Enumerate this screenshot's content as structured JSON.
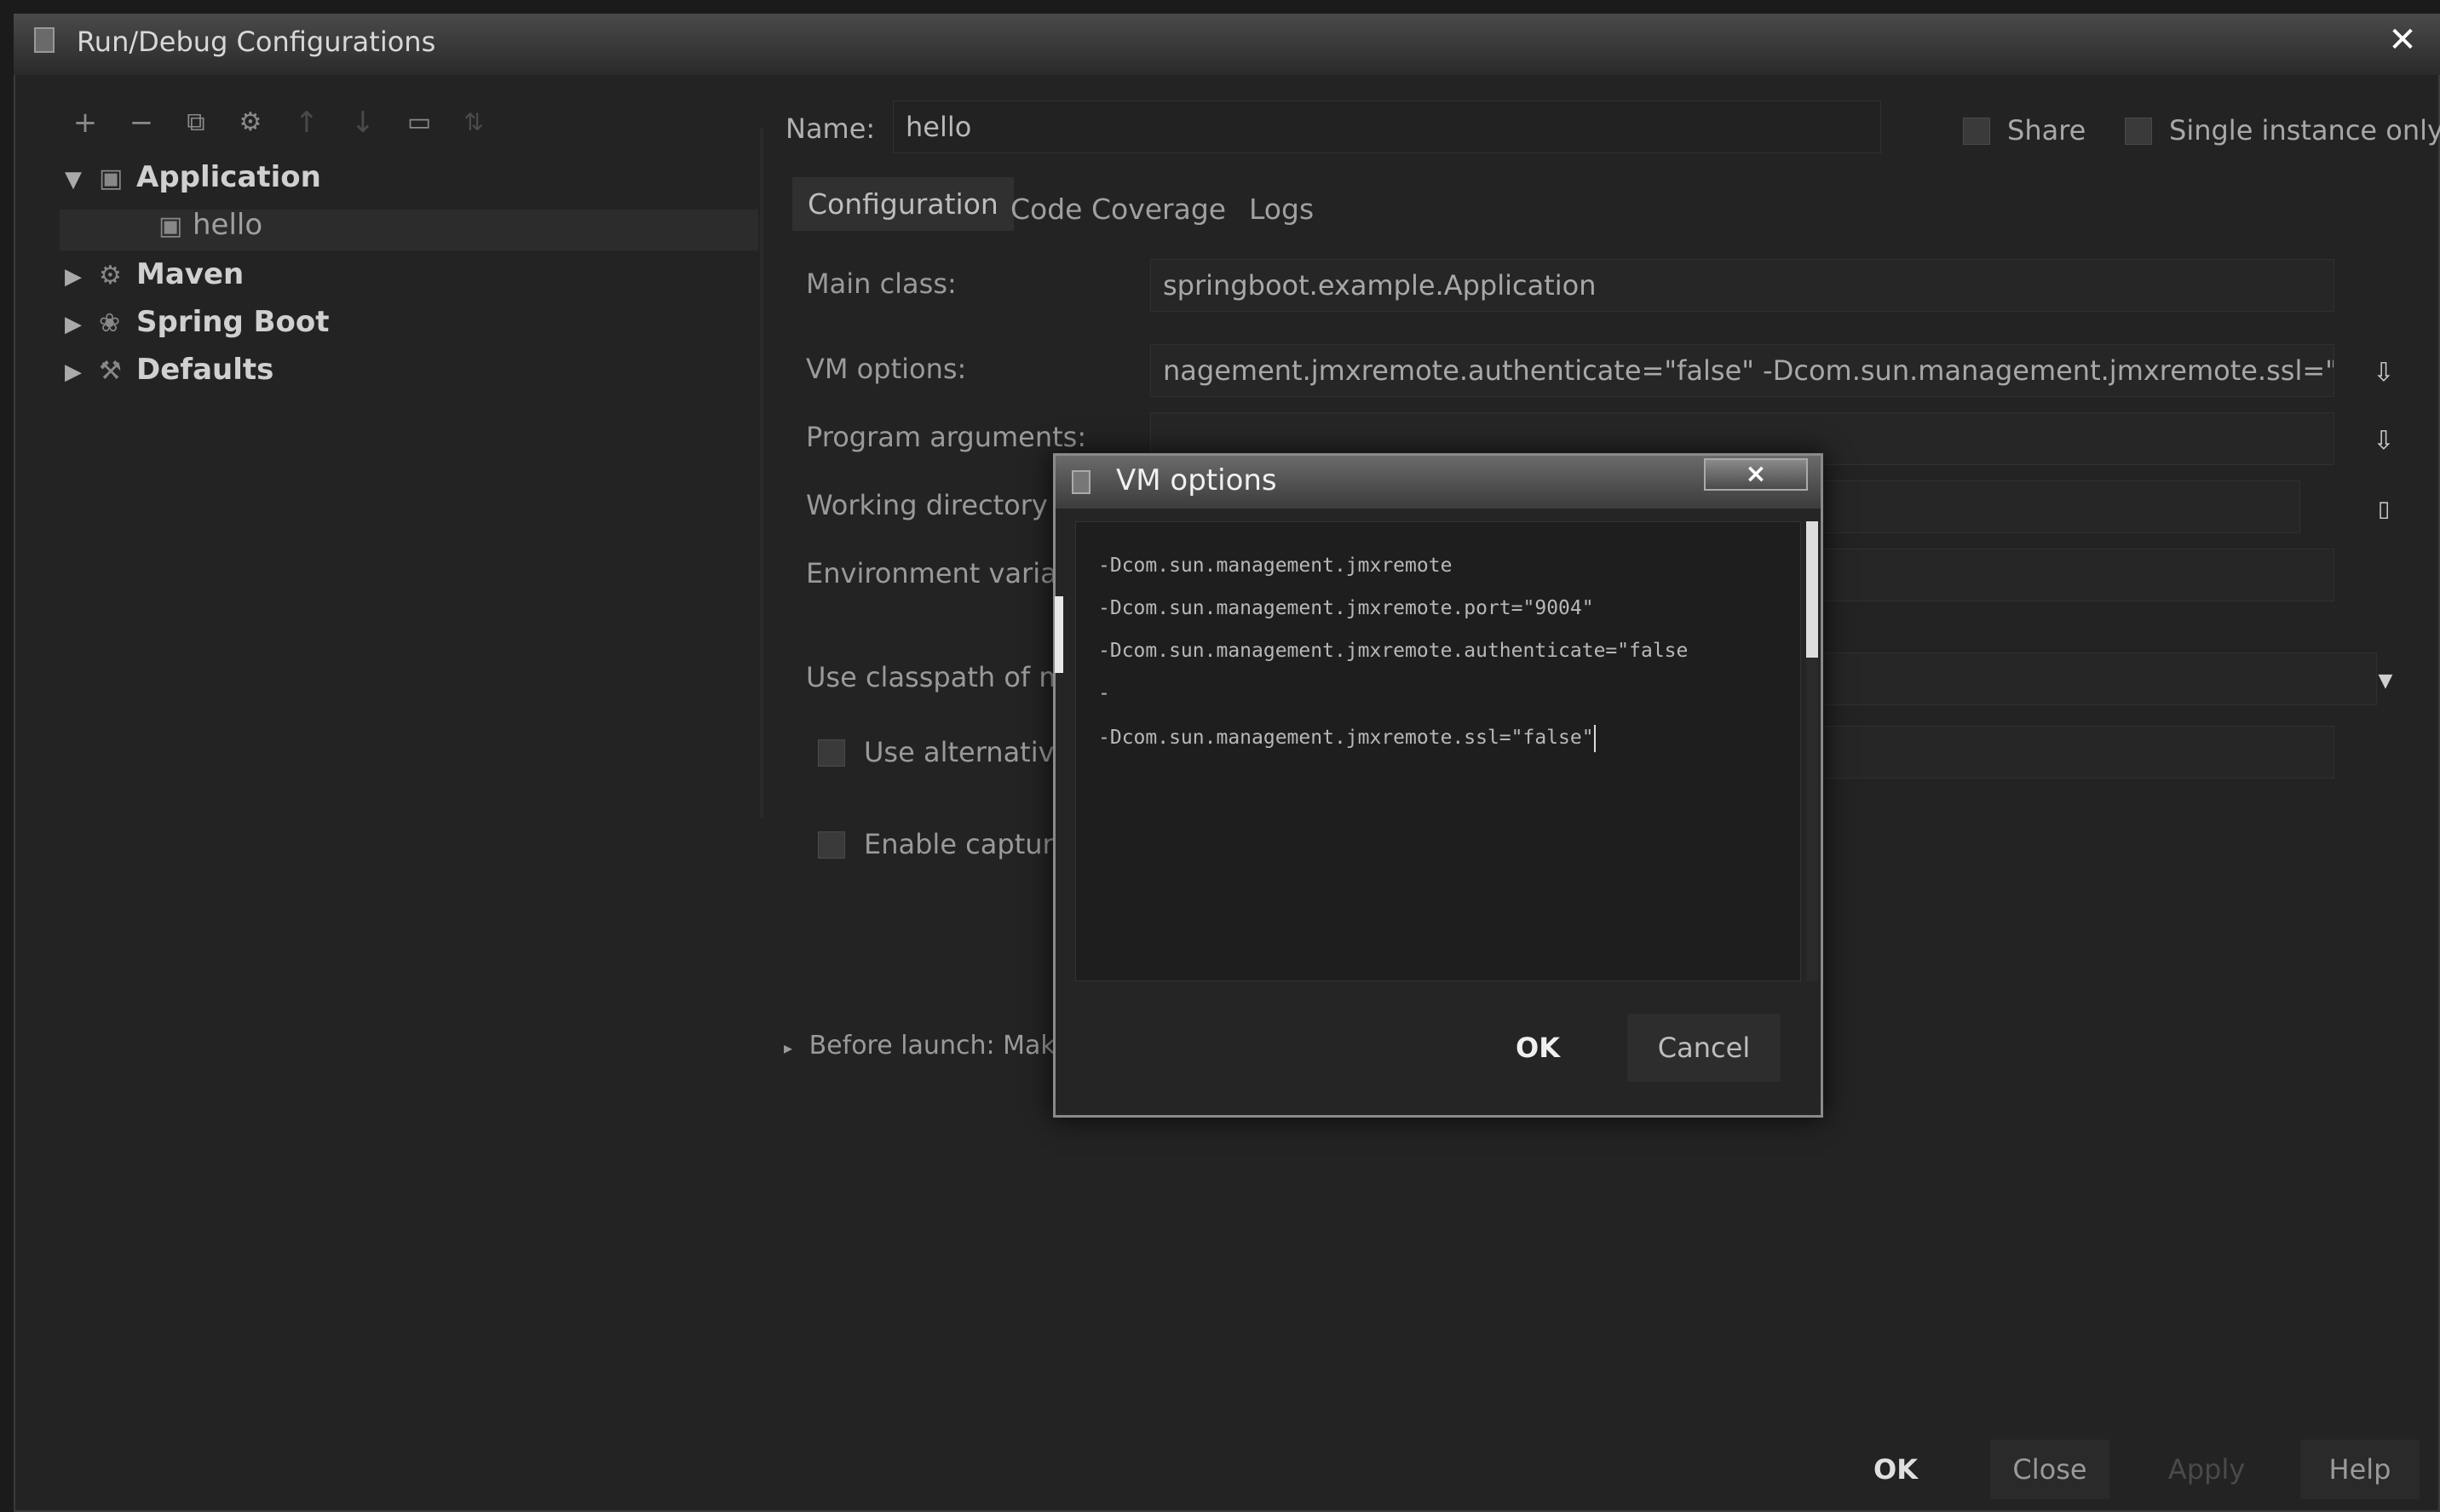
{
  "window": {
    "title": "Run/Debug Configurations"
  },
  "toolbar": {
    "icons": [
      "add-icon",
      "remove-icon",
      "copy-icon",
      "settings-icon",
      "move-up-icon",
      "move-down-icon",
      "folder-icon",
      "sort-icon"
    ]
  },
  "tree": {
    "application": "Application",
    "hello": "hello",
    "maven": "Maven",
    "spring_boot": "Spring Boot",
    "defaults": "Defaults"
  },
  "form": {
    "name_label": "Name:",
    "name_value": "hello",
    "share_label": "Share",
    "single_instance_label": "Single instance only",
    "tabs": [
      "Configuration",
      "Code Coverage",
      "Logs"
    ],
    "main_class_label": "Main class:",
    "main_class_value": "springboot.example.Application",
    "vm_options_label": "VM options:",
    "vm_options_value": "nagement.jmxremote.authenticate=\"false\" -Dcom.sun.management.jmxremote.ssl=\"false\"",
    "program_args_label": "Program arguments:",
    "working_dir_label": "Working directory",
    "env_vars_label": "Environment varial",
    "classpath_label": "Use classpath of m",
    "use_alternative_label": "Use alternativ",
    "enable_capture_label": "Enable captur",
    "before_launch_label": "Before launch: Make"
  },
  "dialog_buttons": {
    "ok": "OK",
    "close": "Close",
    "apply": "Apply",
    "help": "Help"
  },
  "modal": {
    "title": "VM options",
    "close": "×",
    "lines": [
      "-Dcom.sun.management.jmxremote",
      "-Dcom.sun.management.jmxremote.port=\"9004\"",
      "-Dcom.sun.management.jmxremote.authenticate=\"false",
      "-",
      "-Dcom.sun.management.jmxremote.ssl=\"false\""
    ],
    "ok": "OK",
    "cancel": "Cancel"
  }
}
